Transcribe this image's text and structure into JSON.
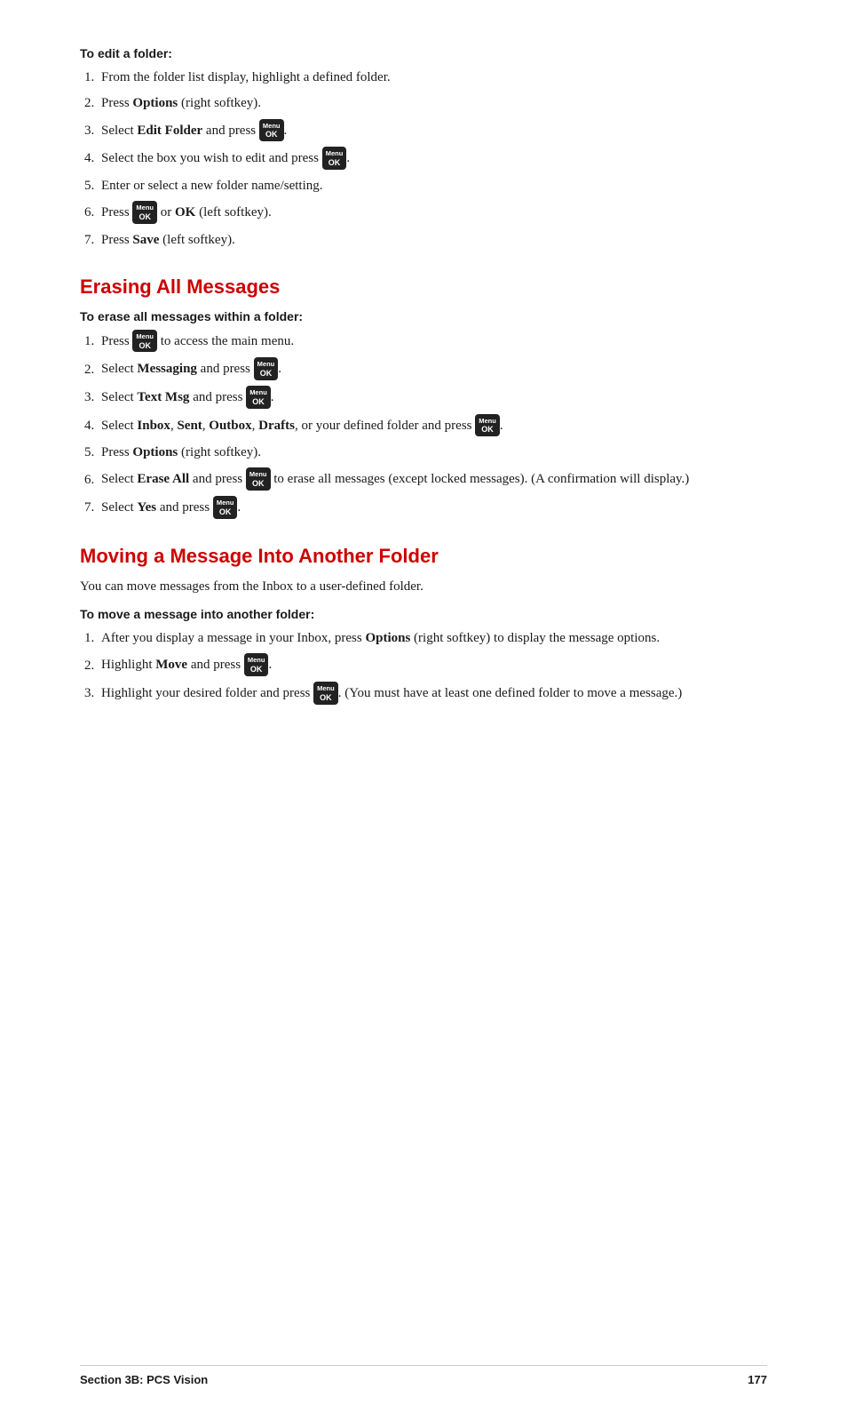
{
  "page": {
    "edit_folder_section": {
      "heading": "To edit a folder:",
      "steps": [
        "From the folder list display, highlight a defined folder.",
        "Press <strong>Options</strong> (right softkey).",
        "Select <strong>Edit Folder</strong> and press [KEY].",
        "Select the box you wish to edit and press [KEY].",
        "Enter or select a new folder name/setting.",
        "Press [KEY] or <strong>OK</strong> (left softkey).",
        "Press <strong>Save</strong> (left softkey)."
      ]
    },
    "erasing_section": {
      "heading": "Erasing All Messages",
      "subheading": "To erase all messages within a folder:",
      "steps": [
        "Press [KEY] to access the main menu.",
        "Select <strong>Messaging</strong> and press [KEY].",
        "Select <strong>Text Msg</strong> and press [KEY].",
        "Select <strong>Inbox</strong>, <strong>Sent</strong>, <strong>Outbox</strong>, <strong>Drafts</strong>, or your defined folder and press [KEY].",
        "Press <strong>Options</strong> (right softkey).",
        "Select <strong>Erase All</strong> and press [KEY] to erase all messages (except locked messages). (A confirmation will display.)",
        "Select <strong>Yes</strong> and press [KEY]."
      ]
    },
    "moving_section": {
      "heading": "Moving a Message Into Another Folder",
      "intro": "You can move messages from the Inbox to a user-defined folder.",
      "subheading": "To move a message into another folder:",
      "steps": [
        "After you display a message in your Inbox, press <strong>Options</strong> (right softkey) to display the message options.",
        "Highlight <strong>Move</strong> and press [KEY].",
        "Highlight your desired folder and press [KEY]. (You must have at least one defined folder to move a message.)"
      ]
    },
    "footer": {
      "left": "Section 3B: PCS Vision",
      "right": "177"
    }
  }
}
